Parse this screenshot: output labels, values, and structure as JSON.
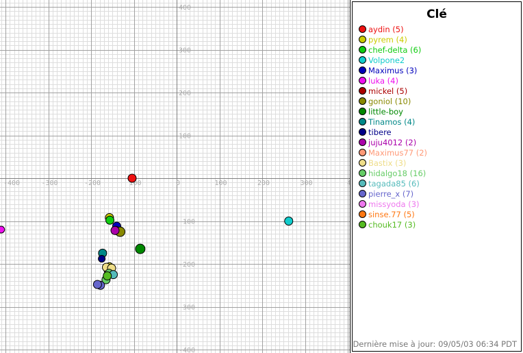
{
  "legend_title": "Clé",
  "updated_text": "Dernière mise à jour: 09/05/03 06:34 PDT",
  "chart_data": {
    "type": "scatter",
    "xlim": [
      -415,
      410
    ],
    "ylim": [
      -410,
      410
    ],
    "xticks": [
      -400,
      -300,
      -200,
      -100,
      0,
      100,
      200,
      300,
      400
    ],
    "yticks": [
      400,
      300,
      200,
      100,
      -100,
      -200,
      -300,
      -400
    ],
    "xtick_labels": [
      "-400",
      "-300",
      "-200",
      "100",
      "0",
      "100",
      "200",
      "300",
      "4"
    ],
    "ytick_labels": [
      "400",
      "300",
      "200",
      "100",
      "-100",
      "-200",
      "-300",
      "-400"
    ],
    "grid": true,
    "legend_position": "right",
    "series": [
      {
        "name": "aydin (5)",
        "color": "#ee1111",
        "points": [
          {
            "x": -104,
            "y": 0,
            "r": 6
          }
        ]
      },
      {
        "name": "pyrem (4)",
        "color": "#cccc00",
        "points": [
          {
            "x": -157,
            "y": -92,
            "r": 6
          },
          {
            "x": -157,
            "y": -205,
            "r": 5
          }
        ]
      },
      {
        "name": "chef-delta (6)",
        "color": "#11cc11",
        "points": [
          {
            "x": -156,
            "y": -98,
            "r": 6
          }
        ]
      },
      {
        "name": "Volpone2",
        "color": "#11cccc",
        "points": [
          {
            "x": 262,
            "y": -100,
            "r": 6
          }
        ]
      },
      {
        "name": "Maximus (3)",
        "color": "#0000bb",
        "points": [
          {
            "x": -140,
            "y": -112,
            "r": 6
          }
        ]
      },
      {
        "name": "luka (4)",
        "color": "#ee11ee",
        "points": [
          {
            "x": -410,
            "y": -120,
            "r": 5
          }
        ]
      },
      {
        "name": "mickel (5)",
        "color": "#aa0000",
        "points": [
          {
            "x": -142,
            "y": -122,
            "r": 6
          }
        ]
      },
      {
        "name": "goniol (10)",
        "color": "#888800",
        "points": [
          {
            "x": -132,
            "y": -125,
            "r": 7
          }
        ]
      },
      {
        "name": "little-boy",
        "color": "#008800",
        "points": [
          {
            "x": -85,
            "y": -165,
            "r": 7
          }
        ]
      },
      {
        "name": "Tinamos (4)",
        "color": "#008888",
        "points": [
          {
            "x": -173,
            "y": -175,
            "r": 6
          }
        ]
      },
      {
        "name": "tibere",
        "color": "#000088",
        "points": [
          {
            "x": -175,
            "y": -188,
            "r": 5
          }
        ]
      },
      {
        "name": "juju4012 (2)",
        "color": "#aa00aa",
        "points": [
          {
            "x": -144,
            "y": -122,
            "r": 6
          }
        ]
      },
      {
        "name": "Maximus77 (2)",
        "color": "#ff9977",
        "points": [
          {
            "x": -160,
            "y": -215,
            "r": 6
          }
        ]
      },
      {
        "name": "Bastix (3)",
        "color": "#eedd88",
        "points": [
          {
            "x": -164,
            "y": -208,
            "r": 6
          },
          {
            "x": -152,
            "y": -210,
            "r": 6
          }
        ]
      },
      {
        "name": "hidalgo18 (16)",
        "color": "#66cc66",
        "points": [
          {
            "x": -158,
            "y": -222,
            "r": 6
          },
          {
            "x": -165,
            "y": -237,
            "r": 6
          }
        ]
      },
      {
        "name": "tagada85 (6)",
        "color": "#55bbbb",
        "points": [
          {
            "x": -148,
            "y": -225,
            "r": 6
          }
        ]
      },
      {
        "name": "pierre_x (7)",
        "color": "#6666cc",
        "points": [
          {
            "x": -178,
            "y": -250,
            "r": 6
          },
          {
            "x": -185,
            "y": -248,
            "r": 6
          }
        ]
      },
      {
        "name": "missyoda (3)",
        "color": "#ee77ee",
        "points": []
      },
      {
        "name": "sinse.77 (5)",
        "color": "#ff7711",
        "points": []
      },
      {
        "name": "chouk17 (3)",
        "color": "#55bb22",
        "points": [
          {
            "x": -162,
            "y": -228,
            "r": 6
          }
        ]
      }
    ]
  }
}
